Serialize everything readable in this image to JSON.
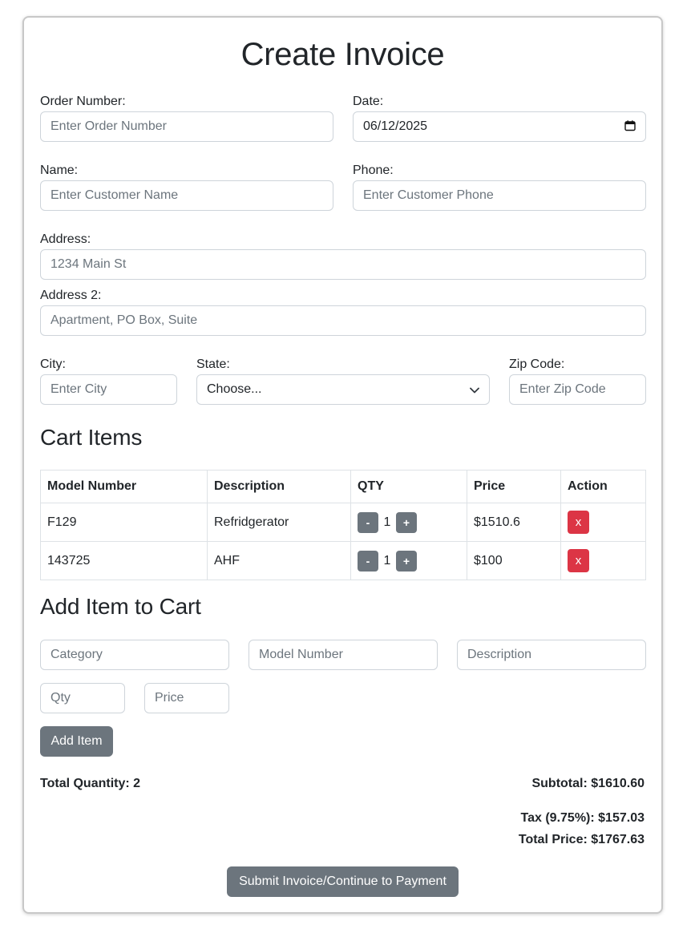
{
  "page": {
    "title": "Create Invoice"
  },
  "form": {
    "order_number": {
      "label": "Order Number:",
      "placeholder": "Enter Order Number",
      "value": ""
    },
    "date": {
      "label": "Date:",
      "value": "06/12/2025"
    },
    "name": {
      "label": "Name:",
      "placeholder": "Enter Customer Name",
      "value": ""
    },
    "phone": {
      "label": "Phone:",
      "placeholder": "Enter Customer Phone",
      "value": ""
    },
    "address": {
      "label": "Address:",
      "placeholder": "1234 Main St",
      "value": ""
    },
    "address2": {
      "label": "Address 2:",
      "placeholder": "Apartment, PO Box, Suite",
      "value": ""
    },
    "city": {
      "label": "City:",
      "placeholder": "Enter City",
      "value": ""
    },
    "state": {
      "label": "State:",
      "value": "Choose..."
    },
    "zip": {
      "label": "Zip Code:",
      "placeholder": "Enter Zip Code",
      "value": ""
    }
  },
  "cart": {
    "heading": "Cart Items",
    "columns": [
      "Model Number",
      "Description",
      "QTY",
      "Price",
      "Action"
    ],
    "rows": [
      {
        "model": "F129",
        "description": "Refridgerator",
        "qty": "1",
        "price": "$1510.6"
      },
      {
        "model": "143725",
        "description": "AHF",
        "qty": "1",
        "price": "$100"
      }
    ],
    "minus_label": "-",
    "plus_label": "+",
    "remove_label": "x"
  },
  "add_item": {
    "heading": "Add Item to Cart",
    "category_placeholder": "Category",
    "model_placeholder": "Model Number",
    "description_placeholder": "Description",
    "qty_placeholder": "Qty",
    "price_placeholder": "Price",
    "button_label": "Add Item"
  },
  "summary": {
    "total_quantity_label": "Total Quantity:",
    "total_quantity": "2",
    "subtotal_label": "Subtotal:",
    "subtotal": "$1610.60",
    "tax_label": "Tax (9.75%):",
    "tax": "$157.03",
    "total_label": "Total Price:",
    "total": "$1767.63"
  },
  "submit": {
    "label": "Submit Invoice/Continue to Payment"
  },
  "colors": {
    "secondary": "#6c757d",
    "danger": "#dc3545",
    "border": "#ced4da"
  }
}
